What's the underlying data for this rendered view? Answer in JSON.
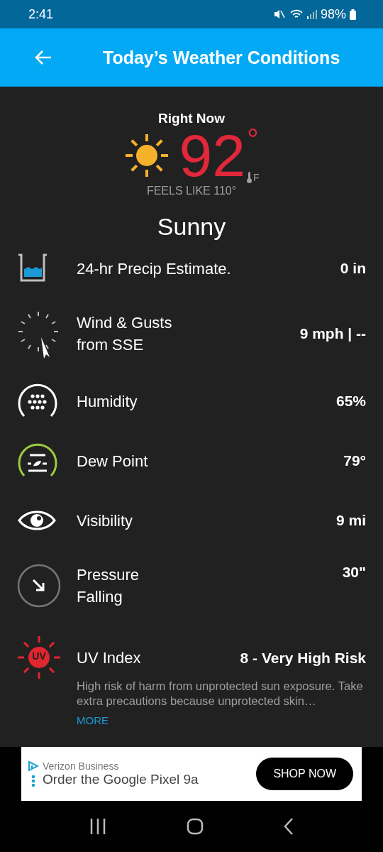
{
  "status_bar": {
    "time": "2:41",
    "battery": "98%"
  },
  "app_bar": {
    "title": "Today’s Weather Conditions"
  },
  "current": {
    "heading": "Right Now",
    "temperature": "92",
    "degree": "°",
    "unit": "F",
    "feels_like": "FEELS LIKE 110°",
    "condition": "Sunny"
  },
  "rows": [
    {
      "kind": "precip",
      "label": "24-hr Precip Estimate.",
      "value": "0 in"
    },
    {
      "kind": "wind",
      "label": "Wind & Gusts",
      "sublabel": "from SSE",
      "value": "9 mph | --"
    },
    {
      "kind": "humidity",
      "label": "Humidity",
      "value": "65%"
    },
    {
      "kind": "dew",
      "label": "Dew Point",
      "value": "79°"
    },
    {
      "kind": "visibility",
      "label": "Visibility",
      "value": "9 mi"
    },
    {
      "kind": "pressure",
      "label": "Pressure",
      "sublabel": "Falling",
      "value": "30\""
    },
    {
      "kind": "uv",
      "badge": "UV",
      "label": "UV Index",
      "value": "8 - Very High Risk",
      "description": "High risk of harm from unprotected sun exposure. Take extra precautions because unprotected skin…",
      "link": "MORE"
    }
  ],
  "ad": {
    "advertiser": "Verizon Business",
    "headline": "Order the Google Pixel 9a",
    "button": "SHOP NOW"
  }
}
